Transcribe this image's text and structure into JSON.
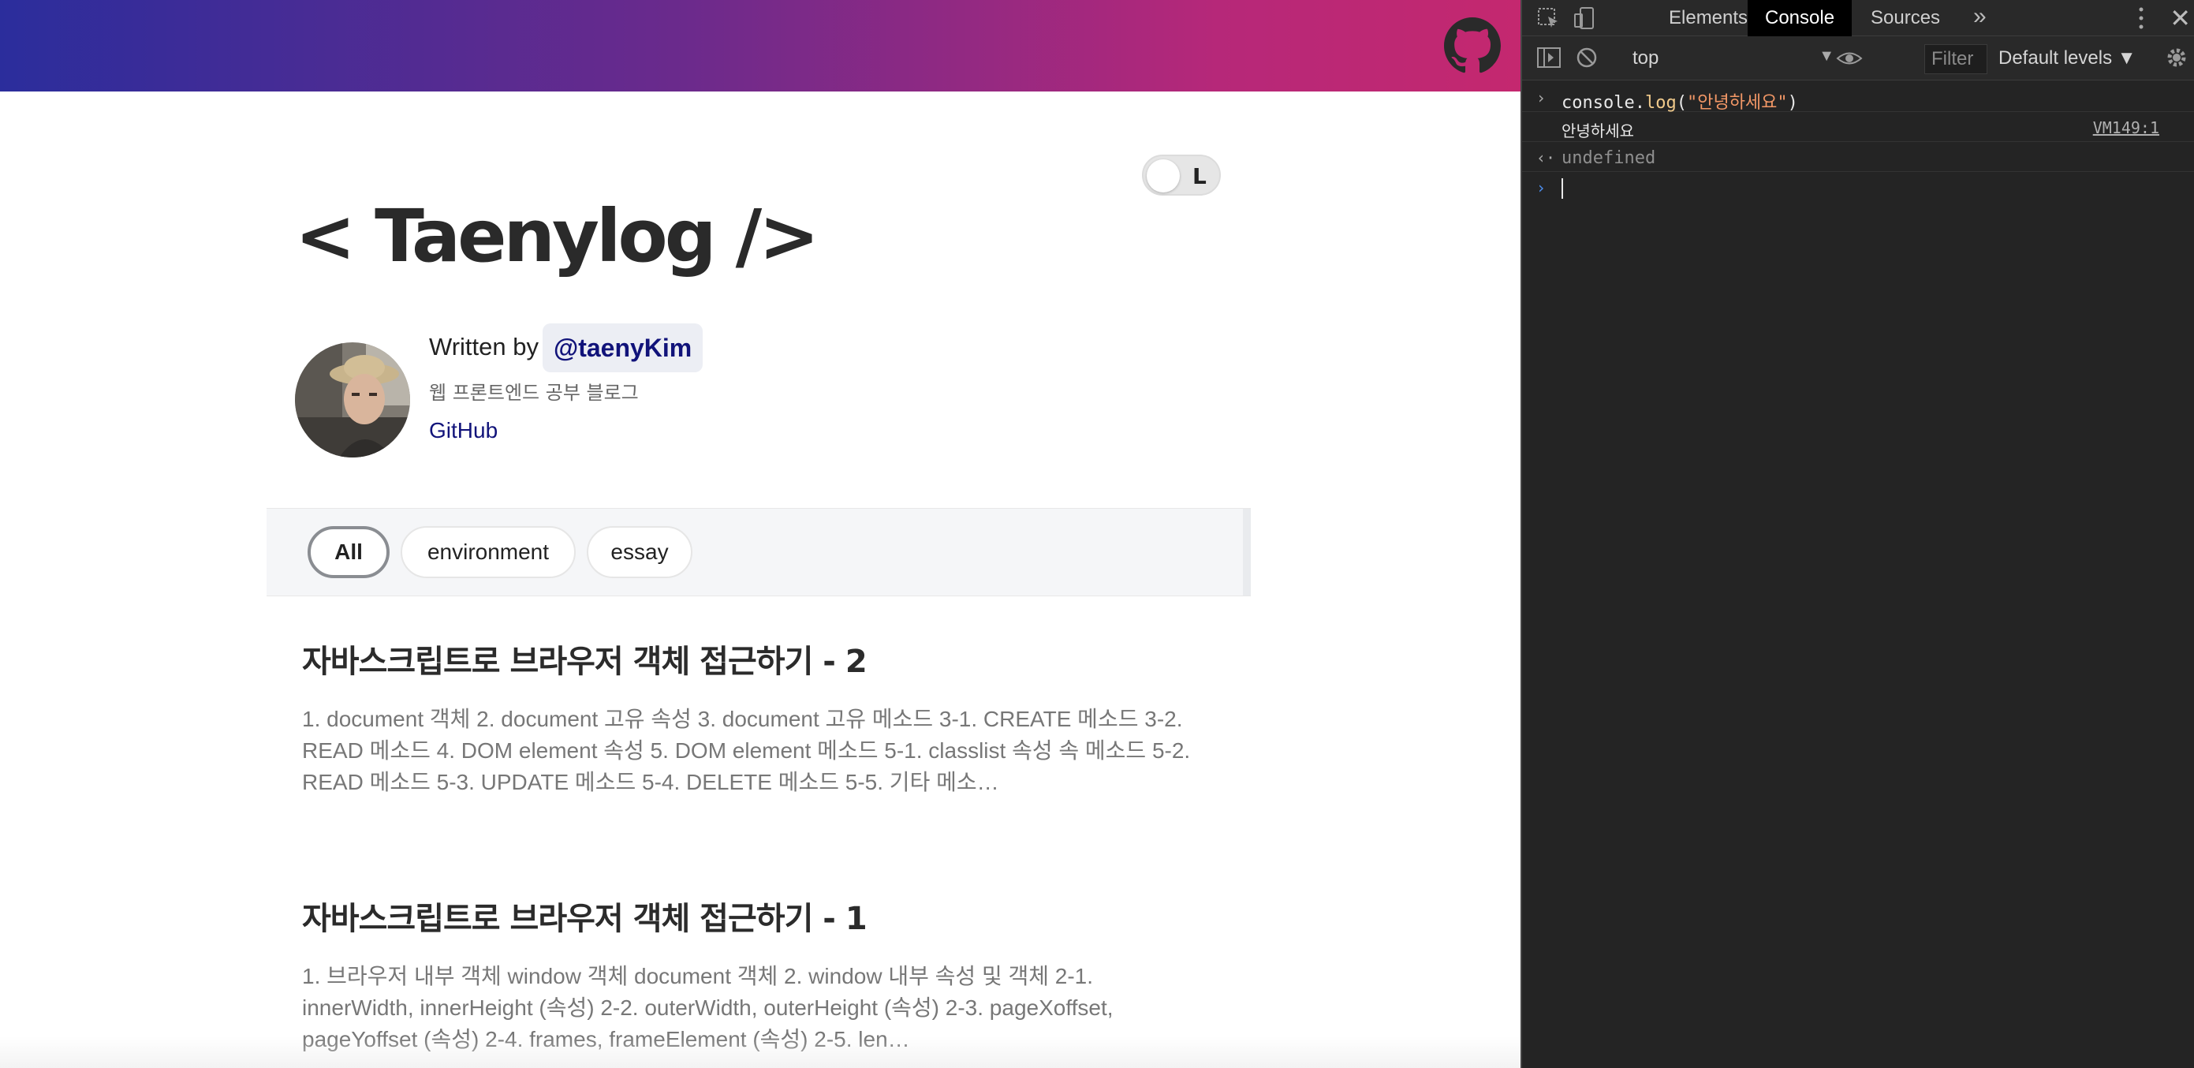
{
  "blog": {
    "title": "< Taenylog />",
    "theme_toggle_label": "L",
    "bio": {
      "written_by": "Written by",
      "author_handle": "@taenyKim",
      "description": "웹 프론트엔드 공부 블로그",
      "github_link": "GitHub"
    },
    "categories": [
      {
        "label": "All",
        "active": true
      },
      {
        "label": "environment",
        "active": false
      },
      {
        "label": "essay",
        "active": false
      }
    ],
    "posts": [
      {
        "title": "자바스크립트로 브라우저 객체 접근하기 - 2",
        "excerpt": "1. document 객체 2. document 고유 속성 3. document 고유 메소드 3-1. CREATE 메소드 3-2. READ 메소드 4. DOM element 속성 5. DOM element 메소드 5-1. classlist 속성 속 메소드 5-2. READ 메소드 5-3. UPDATE 메소드 5-4. DELETE 메소드 5-5. 기타 메소…"
      },
      {
        "title": "자바스크립트로 브라우저 객체 접근하기 - 1",
        "excerpt": "1. 브라우저 내부 객체 window 객체 document 객체 2. window 내부 속성 및 객체 2-1. innerWidth, innerHeight (속성) 2-2. outerWidth, outerHeight (속성) 2-3. pageXoffset, pageYoffset (속성) 2-4. frames, frameElement (속성) 2-5. len…"
      }
    ],
    "colors": {
      "header_start": "#2b2d9c",
      "header_end": "#c4286f",
      "link": "#11137a"
    }
  },
  "devtools": {
    "tabs": [
      {
        "label": "Elements",
        "active": false
      },
      {
        "label": "Console",
        "active": true
      },
      {
        "label": "Sources",
        "active": false
      }
    ],
    "more_tabs": "»",
    "close": "✕",
    "context": "top",
    "filter_placeholder": "Filter",
    "levels": "Default levels ▼",
    "console": {
      "input": {
        "obj": "console.",
        "fn": "log",
        "open": "(",
        "arg": "\"안녕하세요\"",
        "close": ")"
      },
      "output": "안녕하세요",
      "output_source": "VM149:1",
      "return_value": "undefined"
    }
  }
}
